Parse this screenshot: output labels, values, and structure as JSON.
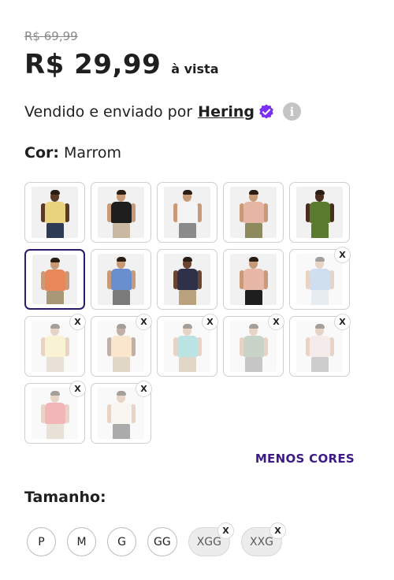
{
  "price": {
    "old": "R$ 69,99",
    "current": "R$ 29,99",
    "suffix": "à vista"
  },
  "seller": {
    "prefix": "Vendido e enviado por",
    "name": "Hering",
    "verified_icon": "verified-badge-icon",
    "info_icon": "info-icon"
  },
  "color": {
    "label": "Cor:",
    "selected": "Marrom"
  },
  "swatches": [
    {
      "shirt": "#e9d37e",
      "skin": "#5a3a25",
      "pants": "#2e3b55",
      "available": true
    },
    {
      "shirt": "#1e1e1e",
      "skin": "#c89a78",
      "pants": "#c9b8a2",
      "available": true
    },
    {
      "shirt": "#f3f3f3",
      "skin": "#c89a78",
      "pants": "#8a8a8a",
      "available": true
    },
    {
      "shirt": "#e6b6a4",
      "skin": "#c89a78",
      "pants": "#8d8a5d",
      "available": true
    },
    {
      "shirt": "#5a7a2e",
      "skin": "#4a2e1d",
      "pants": "#5a7a2e",
      "available": true
    },
    {
      "shirt": "#e8885a",
      "skin": "#c89a78",
      "pants": "#a89878",
      "available": true
    },
    {
      "shirt": "#6a8fcf",
      "skin": "#c89a78",
      "pants": "#7a7a7a",
      "available": true
    },
    {
      "shirt": "#2f3148",
      "skin": "#6a4530",
      "pants": "#b9a27c",
      "available": true
    },
    {
      "shirt": "#e8b8a6",
      "skin": "#c89a78",
      "pants": "#1e1e1e",
      "available": true
    },
    {
      "shirt": "#8fb5dc",
      "skin": "#c89a78",
      "pants": "#c8d2dc",
      "available": false
    },
    {
      "shirt": "#f3e39a",
      "skin": "#c89a78",
      "pants": "#c9b8a2",
      "available": false
    },
    {
      "shirt": "#f2c48a",
      "skin": "#6a4530",
      "pants": "#b9a27c",
      "available": false
    },
    {
      "shirt": "#5fbdbd",
      "skin": "#c89a78",
      "pants": "#b9a27c",
      "available": false
    },
    {
      "shirt": "#7f9a7f",
      "skin": "#c89a78",
      "pants": "#7a7a7a",
      "available": false
    },
    {
      "shirt": "#ead0d0",
      "skin": "#c89a78",
      "pants": "#8a8a8a",
      "available": false
    },
    {
      "shirt": "#e2545a",
      "skin": "#c89a78",
      "pants": "#c9b8a2",
      "available": false
    },
    {
      "shirt": "#f3e8e0",
      "skin": "#c89a78",
      "pants": "#3a3a3a",
      "available": false
    }
  ],
  "selected_swatch": 5,
  "menos_cores": "MENOS CORES",
  "size": {
    "title": "Tamanho:",
    "options": [
      {
        "label": "P",
        "available": true
      },
      {
        "label": "M",
        "available": true
      },
      {
        "label": "G",
        "available": true
      },
      {
        "label": "GG",
        "available": true
      },
      {
        "label": "XGG",
        "available": false
      },
      {
        "label": "XXG",
        "available": false
      }
    ]
  },
  "unavailable_mark": "X",
  "colors": {
    "accent": "#3d1a85",
    "selected_border": "#2e1a6b",
    "verified": "#7b2ff2"
  }
}
